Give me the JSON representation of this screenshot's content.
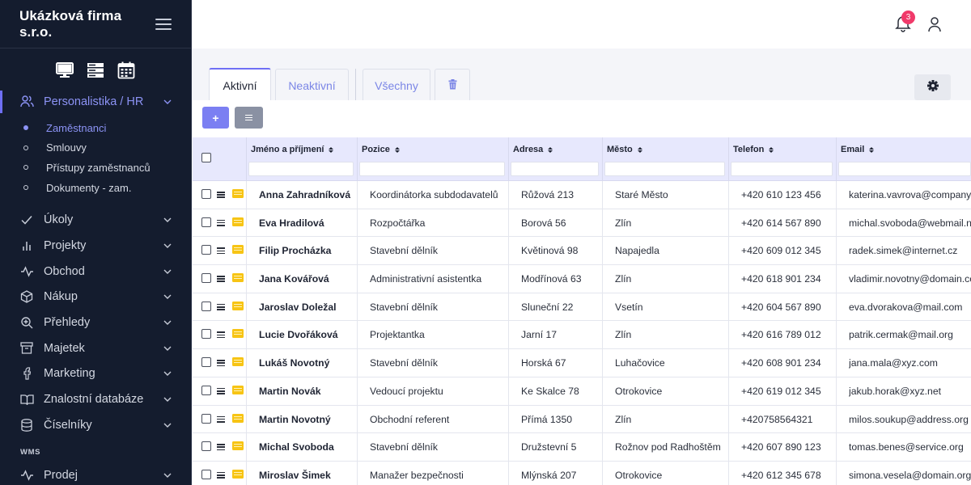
{
  "app": {
    "company": "Ukázková firma s.r.o."
  },
  "view_icons": [
    "desktop-icon",
    "list-view-icon",
    "calendar-icon"
  ],
  "sidebar": {
    "items": [
      {
        "label": "Personalistika / HR",
        "icon": "users-icon",
        "active": true
      },
      {
        "label": "Úkoly",
        "icon": "check-icon"
      },
      {
        "label": "Projekty",
        "icon": "bar-chart-icon"
      },
      {
        "label": "Obchod",
        "icon": "activity-icon"
      },
      {
        "label": "Nákup",
        "icon": "box-icon"
      },
      {
        "label": "Přehledy",
        "icon": "zoom-icon"
      },
      {
        "label": "Majetek",
        "icon": "archive-icon"
      },
      {
        "label": "Marketing",
        "icon": "facebook-icon"
      },
      {
        "label": "Znalostní databáze",
        "icon": "book-icon"
      },
      {
        "label": "Číselníky",
        "icon": "database-icon"
      }
    ],
    "subitems": [
      {
        "label": "Zaměstnanci",
        "active": true
      },
      {
        "label": "Smlouvy"
      },
      {
        "label": "Přístupy zaměstnanců"
      },
      {
        "label": "Dokumenty - zam."
      }
    ],
    "section_label": "WMS",
    "wms_items": [
      {
        "label": "Prodej",
        "icon": "activity-icon"
      }
    ]
  },
  "topbar": {
    "notifications_count": "3"
  },
  "tabs": [
    {
      "label": "Aktivní",
      "active": true
    },
    {
      "label": "Neaktivní"
    },
    {
      "label": "Všechny"
    }
  ],
  "toolbar": {
    "add_label": "+"
  },
  "table": {
    "columns": [
      "Jméno a příjmení",
      "Pozice",
      "Adresa",
      "Město",
      "Telefon",
      "Email"
    ],
    "rows": [
      [
        "Anna Zahradníková",
        "Koordinátorka subdodavatelů",
        "Růžová 213",
        "Staré Město",
        "+420 610 123 456",
        "katerina.vavrova@company.com"
      ],
      [
        "Eva Hradilová",
        "Rozpočtářka",
        "Borová 56",
        "Zlín",
        "+420 614 567 890",
        "michal.svoboda@webmail.net"
      ],
      [
        "Filip Procházka",
        "Stavební dělník",
        "Květinová 98",
        "Napajedla",
        "+420 609 012 345",
        "radek.simek@internet.cz"
      ],
      [
        "Jana Kovářová",
        "Administrativní asistentka",
        "Modřínová 63",
        "Zlín",
        "+420 618 901 234",
        "vladimir.novotny@domain.com"
      ],
      [
        "Jaroslav Doležal",
        "Stavební dělník",
        "Sluneční 22",
        "Vsetín",
        "+420 604 567 890",
        "eva.dvorakova@mail.com"
      ],
      [
        "Lucie Dvořáková",
        "Projektantka",
        "Jarní 17",
        "Zlín",
        "+420 616 789 012",
        "patrik.cermak@mail.org"
      ],
      [
        "Lukáš Novotný",
        "Stavební dělník",
        "Horská 67",
        "Luhačovice",
        "+420 608 901 234",
        "jana.mala@xyz.com"
      ],
      [
        "Martin Novák",
        "Vedoucí projektu",
        "Ke Skalce 78",
        "Otrokovice",
        "+420 619 012 345",
        "jakub.horak@xyz.net"
      ],
      [
        "Martin Novotný",
        "Obchodní referent",
        "Přímá 1350",
        "Zlín",
        "+420758564321",
        "milos.soukup@address.org"
      ],
      [
        "Michal Svoboda",
        "Stavební dělník",
        "Družstevní 5",
        "Rožnov pod Radhoštěm",
        "+420 607 890 123",
        "tomas.benes@service.org"
      ],
      [
        "Miroslav Šimek",
        "Manažer bezpečnosti",
        "Mlýnská 207",
        "Otrokovice",
        "+420 612 345 678",
        "simona.vesela@domain.org"
      ]
    ]
  },
  "colors": {
    "accent": "#6f6ff5",
    "sidebar_bg": "#141c2e",
    "badge": "#f03a6a",
    "row_icon": "#f7c414"
  }
}
